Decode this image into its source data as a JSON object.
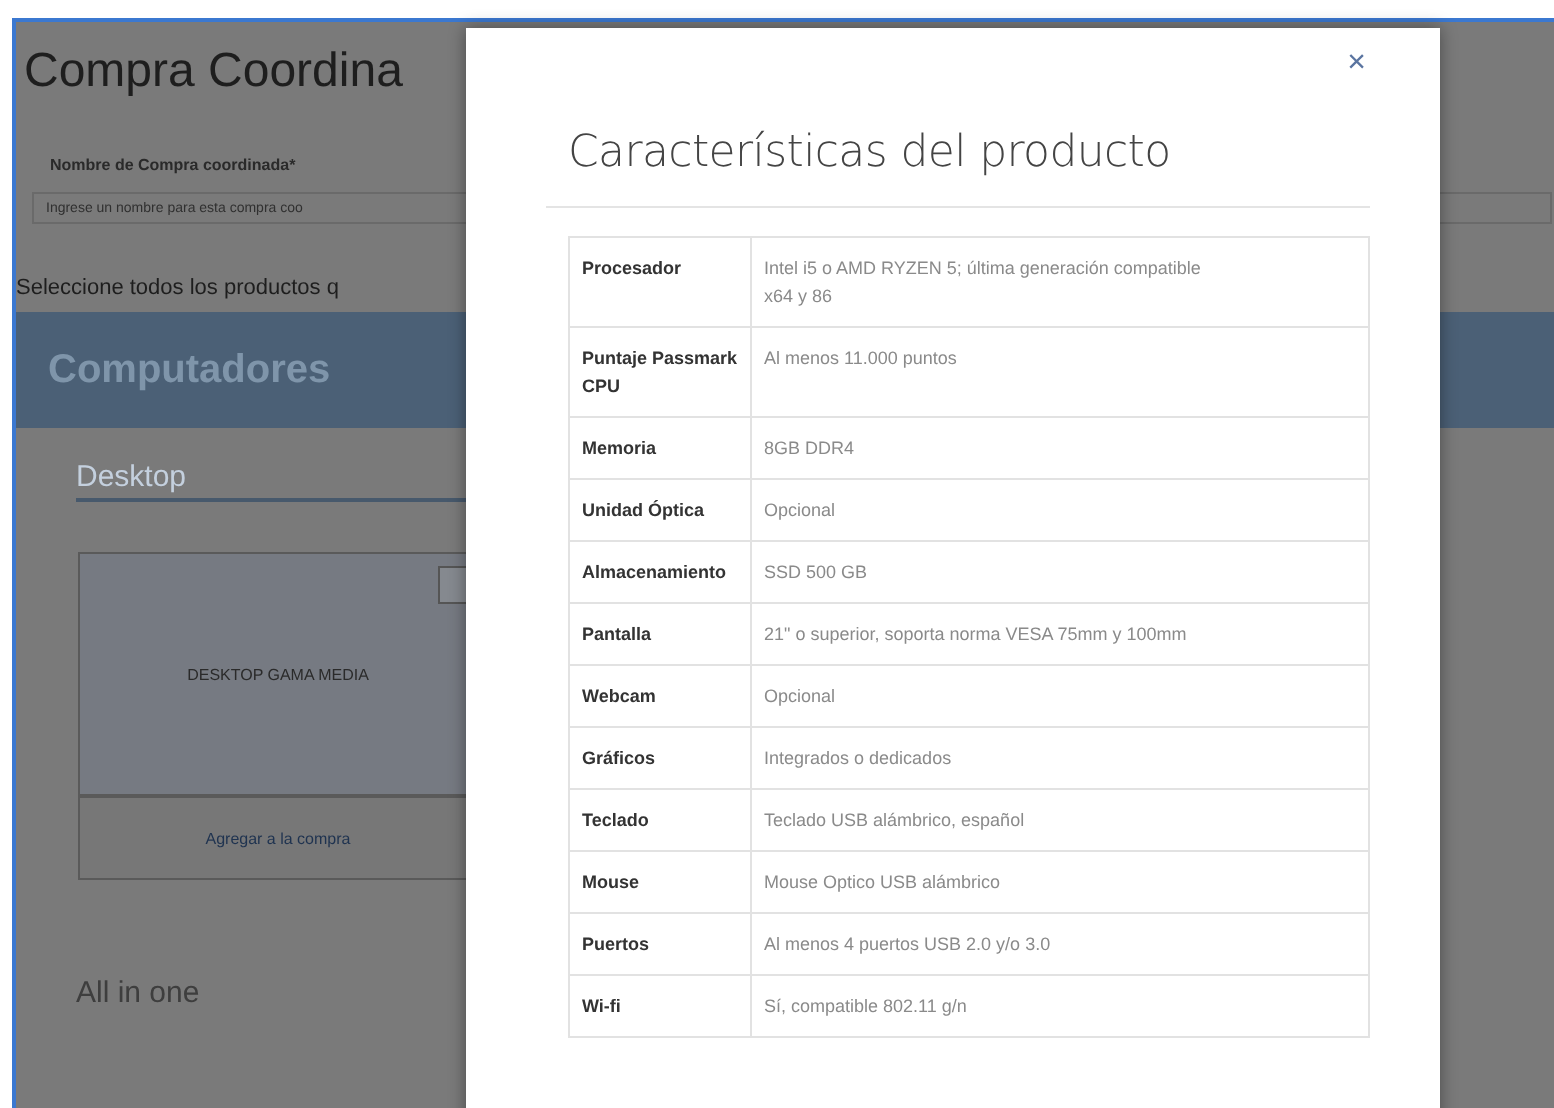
{
  "page": {
    "title": "Compra Coordina",
    "name_field": {
      "label": "Nombre de Compra coordinada*",
      "placeholder": "Ingrese un nombre para esta compra coo"
    },
    "instruction": "Seleccione todos los productos q",
    "category": "Computadores",
    "subcategory": "Desktop",
    "product": {
      "name": "DESKTOP GAMA MEDIA",
      "checked": false,
      "action": "Agregar a la compra"
    },
    "next_subcategory": "All in one"
  },
  "modal": {
    "close": "×",
    "title": "Características del producto",
    "specs": [
      {
        "label": "Procesador",
        "value": "Intel i5 o AMD RYZEN 5; última generación compatible x64 y 86"
      },
      {
        "label": "Puntaje Passmark CPU",
        "value": "Al menos 11.000 puntos"
      },
      {
        "label": "Memoria",
        "value": "8GB DDR4"
      },
      {
        "label": "Unidad Óptica",
        "value": "Opcional"
      },
      {
        "label": "Almacenamiento",
        "value": "SSD 500 GB"
      },
      {
        "label": "Pantalla",
        "value": "21\" o superior, soporta norma VESA 75mm y 100mm"
      },
      {
        "label": "Webcam",
        "value": "Opcional"
      },
      {
        "label": "Gráficos",
        "value": "Integrados o dedicados"
      },
      {
        "label": "Teclado",
        "value": "Teclado USB alámbrico, español"
      },
      {
        "label": "Mouse",
        "value": "Mouse Optico USB alámbrico"
      },
      {
        "label": "Puertos",
        "value": "Al menos 4 puertos USB 2.0 y/o 3.0"
      },
      {
        "label": "Wi-fi",
        "value": "Sí, compatible 802.11 g/n"
      }
    ]
  }
}
